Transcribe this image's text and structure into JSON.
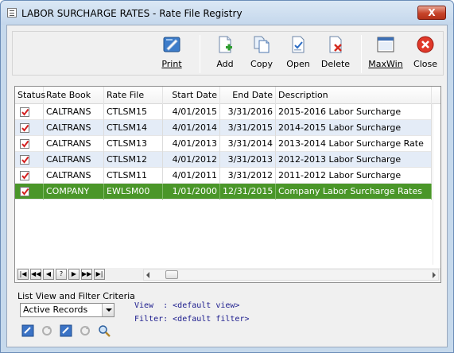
{
  "window": {
    "title": "LABOR SURCHARGE RATES - Rate File Registry",
    "close_glyph": "X"
  },
  "toolbar": {
    "print": "Print",
    "add": "Add",
    "copy": "Copy",
    "open": "Open",
    "delete": "Delete",
    "maxwin": "MaxWin",
    "close": "Close"
  },
  "grid": {
    "columns": [
      "Status",
      "Rate Book",
      "Rate File",
      "Start Date",
      "End Date",
      "Description"
    ],
    "rows": [
      {
        "status": true,
        "rate_book": "CALTRANS",
        "rate_file": "CTLSM15",
        "start": "4/01/2015",
        "end": "3/31/2016",
        "description": "2015-2016 Labor Surcharge",
        "selected": false
      },
      {
        "status": true,
        "rate_book": "CALTRANS",
        "rate_file": "CTLSM14",
        "start": "4/01/2014",
        "end": "3/31/2015",
        "description": "2014-2015 Labor Surcharge",
        "selected": false
      },
      {
        "status": true,
        "rate_book": "CALTRANS",
        "rate_file": "CTLSM13",
        "start": "4/01/2013",
        "end": "3/31/2014",
        "description": "2013-2014 Labor Surcharge Rate",
        "selected": false
      },
      {
        "status": true,
        "rate_book": "CALTRANS",
        "rate_file": "CTLSM12",
        "start": "4/01/2012",
        "end": "3/31/2013",
        "description": "2012-2013 Labor Surcharge",
        "selected": false
      },
      {
        "status": true,
        "rate_book": "CALTRANS",
        "rate_file": "CTLSM11",
        "start": "4/01/2011",
        "end": "3/31/2012",
        "description": "2011-2012 Labor Surcharge",
        "selected": false
      },
      {
        "status": true,
        "rate_book": "COMPANY",
        "rate_file": "EWLSM00",
        "start": "1/01/2000",
        "end": "12/31/2015",
        "description": "Company Labor Surcharge Rates",
        "selected": true
      }
    ],
    "nav_buttons": [
      "|◀",
      "◀◀",
      "◀",
      "?",
      "▶",
      "▶▶",
      "▶|"
    ]
  },
  "filter": {
    "label": "List View and Filter Criteria",
    "selected": "Active Records",
    "view_line": "View  : <default view>",
    "filter_line": "Filter: <default filter>"
  },
  "colors": {
    "selected_row": "#4a9629",
    "alt_row": "#e4ecf7",
    "title_bar": "#c6d9ec",
    "close_button": "#c7432a"
  },
  "icons": [
    "print-icon",
    "add-icon",
    "copy-icon",
    "open-icon",
    "delete-icon",
    "maxwin-icon",
    "close-circle-icon"
  ]
}
